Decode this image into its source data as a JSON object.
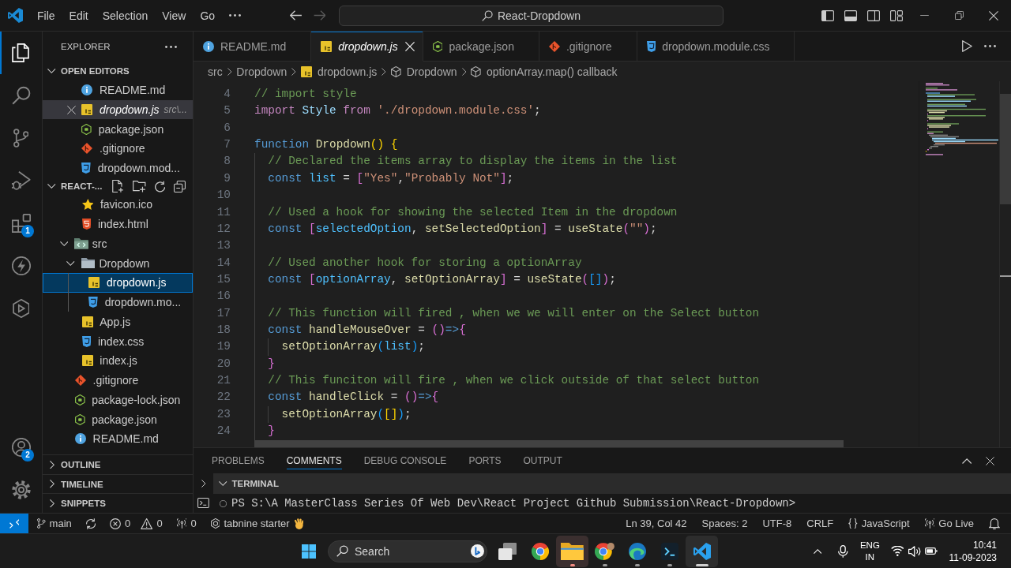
{
  "title_bar": {
    "menus": [
      "File",
      "Edit",
      "Selection",
      "View",
      "Go"
    ],
    "nav": [
      {
        "kind": "back",
        "disabled": false
      },
      {
        "kind": "forward",
        "disabled": true
      }
    ],
    "command_center": "React-Dropdown"
  },
  "activity_bar": {
    "items": [
      {
        "kind": "explorer",
        "selected": true
      },
      {
        "kind": "search",
        "selected": false
      },
      {
        "kind": "source-control",
        "selected": false
      },
      {
        "kind": "run-debug",
        "selected": false
      },
      {
        "kind": "extensions",
        "selected": false,
        "badge": "1"
      },
      {
        "kind": "lightning",
        "selected": false
      },
      {
        "kind": "hexagon",
        "selected": false
      }
    ],
    "bottom": [
      {
        "kind": "account",
        "badge": "2"
      },
      {
        "kind": "settings"
      }
    ]
  },
  "sidebar": {
    "title": "EXPLORER",
    "open_editors": {
      "title": "OPEN EDITORS",
      "expanded": true,
      "items": [
        {
          "name": "README.md",
          "kind": "info",
          "selected": false,
          "preview": false
        },
        {
          "name": "dropdown.js",
          "kind": "js",
          "selected": true,
          "preview": true,
          "description": "src\\..."
        },
        {
          "name": "package.json",
          "kind": "json",
          "selected": false,
          "preview": false
        },
        {
          "name": ".gitignore",
          "kind": "git",
          "selected": false,
          "preview": false
        },
        {
          "name": "dropdown.mod...",
          "kind": "css",
          "selected": false,
          "preview": false
        }
      ]
    },
    "project": {
      "title": "REACT-...",
      "expanded": true,
      "tree": [
        {
          "children": [
            {
              "name": "favicon.ico",
              "kind": "star",
              "selected": false
            },
            {
              "name": "index.html",
              "kind": "html",
              "selected": false
            }
          ]
        },
        {
          "name": "src",
          "kind": "folder-code",
          "selected": false,
          "expanded": true,
          "children": [
            {
              "name": "Dropdown",
              "kind": "folder",
              "selected": false,
              "expanded": true,
              "children": [
                {
                  "name": "dropdown.js",
                  "kind": "js",
                  "selected": true
                },
                {
                  "name": "dropdown.mo...",
                  "kind": "css",
                  "selected": false
                }
              ]
            },
            {
              "name": "App.js",
              "kind": "js",
              "selected": false
            },
            {
              "name": "index.css",
              "kind": "css",
              "selected": false
            },
            {
              "name": "index.js",
              "kind": "js",
              "selected": false
            }
          ]
        },
        {
          "name": ".gitignore",
          "kind": "git",
          "selected": false
        },
        {
          "name": "package-lock.json",
          "kind": "json",
          "selected": false
        },
        {
          "name": "package.json",
          "kind": "json",
          "selected": false
        },
        {
          "name": "README.md",
          "kind": "info",
          "selected": false
        }
      ]
    },
    "sections": [
      {
        "title": "OUTLINE",
        "expanded": false
      },
      {
        "title": "TIMELINE",
        "expanded": false
      },
      {
        "title": "SNIPPETS",
        "expanded": false
      }
    ]
  },
  "editor": {
    "tabs": [
      {
        "label": "README.md",
        "kind": "info",
        "selected": false,
        "preview": false
      },
      {
        "label": "dropdown.js",
        "kind": "js",
        "selected": true,
        "preview": true
      },
      {
        "label": "package.json",
        "kind": "json",
        "selected": false,
        "preview": false
      },
      {
        "label": ".gitignore",
        "kind": "git",
        "selected": false,
        "preview": false
      },
      {
        "label": "dropdown.module.css",
        "kind": "css",
        "selected": false,
        "preview": false
      }
    ],
    "breadcrumbs": [
      {
        "label": "src",
        "kind": "folder"
      },
      {
        "label": "Dropdown",
        "kind": "folder"
      },
      {
        "label": "dropdown.js",
        "kind": "js"
      },
      {
        "label": "Dropdown",
        "kind": "symbol"
      },
      {
        "label": "optionArray.map() callback",
        "kind": "symbol"
      }
    ],
    "lines": [
      {
        "number": "4",
        "tokens": [
          {
            "text": "// import style",
            "kind": "comment"
          }
        ]
      },
      {
        "number": "5",
        "tokens": [
          {
            "text": "import",
            "kind": "control"
          },
          {
            "text": " Style ",
            "kind": "variable"
          },
          {
            "text": "from",
            "kind": "control"
          },
          {
            "text": " './dropdown.module.css'",
            "kind": "string"
          },
          {
            "text": ";",
            "kind": "plain"
          }
        ]
      },
      {
        "number": "6"
      },
      {
        "number": "7",
        "tokens": [
          {
            "text": "function ",
            "kind": "keyword"
          },
          {
            "text": "Dropdown",
            "kind": "function"
          },
          {
            "text": "()",
            "kind": "bracket-1"
          },
          {
            "text": " {",
            "kind": "bracket-1"
          }
        ]
      },
      {
        "number": "8",
        "tokens": [
          {
            "text": "  // Declared the items array to display the items in the list",
            "kind": "comment"
          }
        ]
      },
      {
        "number": "9",
        "tokens": [
          {
            "text": "  const ",
            "kind": "keyword"
          },
          {
            "text": "list",
            "kind": "constant"
          },
          {
            "text": " = ",
            "kind": "plain"
          },
          {
            "text": "[",
            "kind": "bracket-2"
          },
          {
            "text": "\"Yes\"",
            "kind": "string"
          },
          {
            "text": ",",
            "kind": "plain"
          },
          {
            "text": "\"Probably Not\"",
            "kind": "string"
          },
          {
            "text": "]",
            "kind": "bracket-2"
          },
          {
            "text": ";",
            "kind": "plain"
          }
        ]
      },
      {
        "number": "10"
      },
      {
        "number": "11",
        "tokens": [
          {
            "text": "  // Used a hook for showing the selected Item in the dropdown",
            "kind": "comment"
          }
        ]
      },
      {
        "number": "12",
        "tokens": [
          {
            "text": "  const ",
            "kind": "keyword"
          },
          {
            "text": "[",
            "kind": "bracket-2"
          },
          {
            "text": "selectedOption",
            "kind": "constant"
          },
          {
            "text": ", ",
            "kind": "plain"
          },
          {
            "text": "setSelectedOption",
            "kind": "function"
          },
          {
            "text": "]",
            "kind": "bracket-2"
          },
          {
            "text": " = ",
            "kind": "plain"
          },
          {
            "text": "useState",
            "kind": "function"
          },
          {
            "text": "(",
            "kind": "bracket-2"
          },
          {
            "text": "\"\"",
            "kind": "string"
          },
          {
            "text": ")",
            "kind": "bracket-2"
          },
          {
            "text": ";",
            "kind": "plain"
          }
        ]
      },
      {
        "number": "13"
      },
      {
        "number": "14",
        "tokens": [
          {
            "text": "  // Used another hook for storing a optionArray",
            "kind": "comment"
          }
        ]
      },
      {
        "number": "15",
        "tokens": [
          {
            "text": "  const ",
            "kind": "keyword"
          },
          {
            "text": "[",
            "kind": "bracket-2"
          },
          {
            "text": "optionArray",
            "kind": "constant"
          },
          {
            "text": ", ",
            "kind": "plain"
          },
          {
            "text": "setOptionArray",
            "kind": "function"
          },
          {
            "text": "]",
            "kind": "bracket-2"
          },
          {
            "text": " = ",
            "kind": "plain"
          },
          {
            "text": "useState",
            "kind": "function"
          },
          {
            "text": "(",
            "kind": "bracket-2"
          },
          {
            "text": "[]",
            "kind": "bracket-3"
          },
          {
            "text": ")",
            "kind": "bracket-2"
          },
          {
            "text": ";",
            "kind": "plain"
          }
        ]
      },
      {
        "number": "16"
      },
      {
        "number": "17",
        "tokens": [
          {
            "text": "  // This function will fired , when we we will enter on the Select button",
            "kind": "comment"
          }
        ]
      },
      {
        "number": "18",
        "tokens": [
          {
            "text": "  const ",
            "kind": "keyword"
          },
          {
            "text": "handleMouseOver",
            "kind": "function"
          },
          {
            "text": " = ",
            "kind": "plain"
          },
          {
            "text": "()",
            "kind": "bracket-2"
          },
          {
            "text": "=>",
            "kind": "keyword"
          },
          {
            "text": "{",
            "kind": "bracket-2"
          }
        ]
      },
      {
        "number": "19",
        "tokens": [
          {
            "text": "    setOptionArray",
            "kind": "function"
          },
          {
            "text": "(",
            "kind": "bracket-3"
          },
          {
            "text": "list",
            "kind": "constant"
          },
          {
            "text": ")",
            "kind": "bracket-3"
          },
          {
            "text": ";",
            "kind": "plain"
          }
        ]
      },
      {
        "number": "20",
        "tokens": [
          {
            "text": "  }",
            "kind": "bracket-2"
          }
        ]
      },
      {
        "number": "21",
        "tokens": [
          {
            "text": "  // This funciton will fire , when we click outside of that select button",
            "kind": "comment"
          }
        ]
      },
      {
        "number": "22",
        "tokens": [
          {
            "text": "  const ",
            "kind": "keyword"
          },
          {
            "text": "handleClick",
            "kind": "function"
          },
          {
            "text": " = ",
            "kind": "plain"
          },
          {
            "text": "()",
            "kind": "bracket-2"
          },
          {
            "text": "=>",
            "kind": "keyword"
          },
          {
            "text": "{",
            "kind": "bracket-2"
          }
        ]
      },
      {
        "number": "23",
        "tokens": [
          {
            "text": "    setOptionArray",
            "kind": "function"
          },
          {
            "text": "(",
            "kind": "bracket-3"
          },
          {
            "text": "[]",
            "kind": "bracket-1"
          },
          {
            "text": ")",
            "kind": "bracket-3"
          },
          {
            "text": ";",
            "kind": "plain"
          }
        ]
      },
      {
        "number": "24",
        "tokens": [
          {
            "text": "  }",
            "kind": "bracket-2"
          }
        ]
      }
    ]
  },
  "panel": {
    "tabs": [
      {
        "label": "PROBLEMS",
        "selected": false
      },
      {
        "label": "COMMENTS",
        "selected": true
      },
      {
        "label": "DEBUG CONSOLE",
        "selected": false
      },
      {
        "label": "PORTS",
        "selected": false
      },
      {
        "label": "OUTPUT",
        "selected": false
      }
    ],
    "terminal": {
      "title": "TERMINAL",
      "expanded": true,
      "prompt": "PS S:\\A MasterClass Series Of Web Dev\\React Project Github Submission\\React-Dropdown>"
    }
  },
  "status_bar": {
    "left": [
      {
        "kind": "branch",
        "text": "main"
      },
      {
        "kind": "sync"
      },
      {
        "kind": "problems",
        "errors": "0",
        "warnings": "0"
      },
      {
        "kind": "ports",
        "text": "0"
      },
      {
        "kind": "tabnine",
        "text": "tabnine starter"
      }
    ],
    "right": [
      {
        "kind": "cursor",
        "text": "Ln 39, Col 42"
      },
      {
        "kind": "indentation",
        "text": "Spaces: 2"
      },
      {
        "kind": "encoding",
        "text": "UTF-8"
      },
      {
        "kind": "eol",
        "text": "CRLF"
      },
      {
        "kind": "language",
        "text": "JavaScript"
      },
      {
        "kind": "live-server",
        "text": "Go Live"
      },
      {
        "kind": "notifications"
      }
    ]
  },
  "taskbar": {
    "search": {
      "placeholder": "Search"
    },
    "apps": [
      {
        "kind": "task-view",
        "running": false,
        "selected": false,
        "attention": false
      },
      {
        "kind": "browser",
        "running": false,
        "selected": false,
        "attention": false
      },
      {
        "kind": "folder",
        "running": true,
        "selected": false,
        "attention": true
      },
      {
        "kind": "browser-profile",
        "running": true,
        "selected": false,
        "attention": false
      },
      {
        "kind": "swirl-browser",
        "running": true,
        "selected": false,
        "attention": false
      },
      {
        "kind": "terminal-app",
        "running": true,
        "selected": false,
        "attention": false
      },
      {
        "kind": "code-editor",
        "running": true,
        "selected": true,
        "attention": false
      }
    ],
    "tray": {
      "language": "ENG",
      "region": "IN",
      "time": "10:41",
      "date": "11-09-2023"
    }
  }
}
